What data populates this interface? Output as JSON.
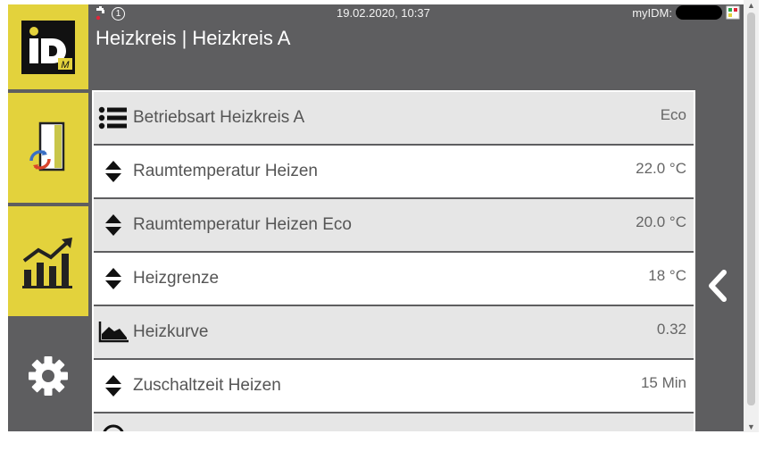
{
  "header": {
    "datetime": "19.02.2020, 10:37",
    "title": "Heizkreis | Heizkreis A",
    "account_label": "myIDM:",
    "info_glyph": "1"
  },
  "sidebar": {
    "logo_text": "iD",
    "logo_sub": "M",
    "items": [
      {
        "icon": "heating-circuit-icon"
      },
      {
        "icon": "statistics-chart-icon"
      },
      {
        "icon": "gear-icon"
      }
    ]
  },
  "list": {
    "rows": [
      {
        "label": "Betriebsart Heizkreis A",
        "value": "Eco",
        "icon": "list-icon"
      },
      {
        "label": "Raumtemperatur Heizen",
        "value": "22.0 °C",
        "icon": "up-down-arrows-icon"
      },
      {
        "label": "Raumtemperatur Heizen Eco",
        "value": "20.0 °C",
        "icon": "up-down-arrows-icon"
      },
      {
        "label": "Heizgrenze",
        "value": "18 °C",
        "icon": "up-down-arrows-icon"
      },
      {
        "label": "Heizkurve",
        "value": "0.32",
        "icon": "curve-chart-icon"
      },
      {
        "label": "Zuschaltzeit Heizen",
        "value": "15 Min",
        "icon": "up-down-arrows-icon"
      }
    ]
  },
  "colors": {
    "accent_yellow": "#e3d23c",
    "frame_gray": "#5e5e60",
    "row_shaded": "#e6e6e6"
  }
}
